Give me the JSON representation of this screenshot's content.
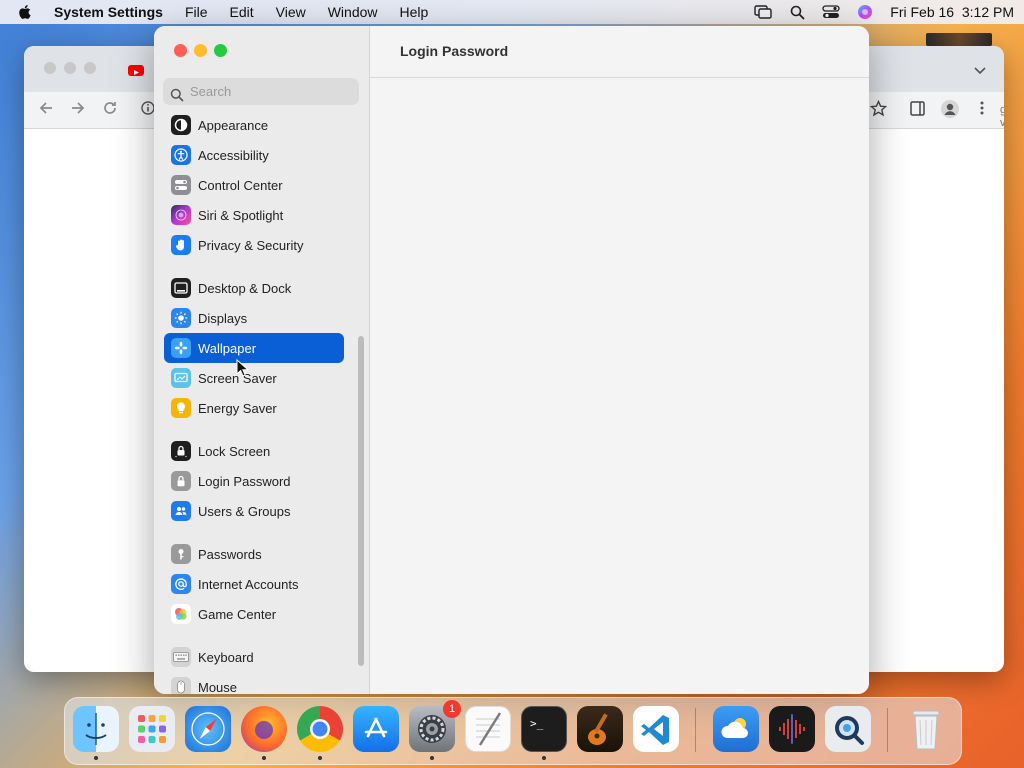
{
  "menubar": {
    "app_name": "System Settings",
    "menus": [
      "File",
      "Edit",
      "View",
      "Window",
      "Help"
    ],
    "clock": "Fri Feb 16  3:12 PM"
  },
  "browser": {
    "edge_text_1": "g",
    "edge_text_2": "v"
  },
  "settings": {
    "search_placeholder": "Search",
    "content_title": "Login Password",
    "sidebar": [
      {
        "label": "Appearance",
        "icon": "appearance-icon",
        "color": "#1f1f1f"
      },
      {
        "label": "Accessibility",
        "icon": "accessibility-icon",
        "color": "#1a73e8"
      },
      {
        "label": "Control Center",
        "icon": "control-center-icon",
        "color": "#8e8e93"
      },
      {
        "label": "Siri & Spotlight",
        "icon": "siri-icon",
        "color": "#b13ad1"
      },
      {
        "label": "Privacy & Security",
        "icon": "hand-icon",
        "color": "#1c7cf4"
      },
      {
        "label": "Desktop & Dock",
        "icon": "desktop-dock-icon",
        "color": "#1f1f1f"
      },
      {
        "label": "Displays",
        "icon": "displays-icon",
        "color": "#2a86f0"
      },
      {
        "label": "Wallpaper",
        "icon": "wallpaper-icon",
        "color": "#3aa1f2",
        "selected": true
      },
      {
        "label": "Screen Saver",
        "icon": "screen-saver-icon",
        "color": "#5bc3e8"
      },
      {
        "label": "Energy Saver",
        "icon": "energy-saver-icon",
        "color": "#f7b500"
      },
      {
        "label": "Lock Screen",
        "icon": "lock-screen-icon",
        "color": "#1f1f1f"
      },
      {
        "label": "Login Password",
        "icon": "lock-icon",
        "color": "#9a9a9a"
      },
      {
        "label": "Users & Groups",
        "icon": "users-icon",
        "color": "#1f7cf0"
      },
      {
        "label": "Passwords",
        "icon": "key-icon",
        "color": "#9a9a9a"
      },
      {
        "label": "Internet Accounts",
        "icon": "at-icon",
        "color": "#2a86f0"
      },
      {
        "label": "Game Center",
        "icon": "game-center-icon",
        "color": "#ffffff"
      },
      {
        "label": "Keyboard",
        "icon": "keyboard-icon",
        "color": "#b5b5b5"
      },
      {
        "label": "Mouse",
        "icon": "mouse-icon",
        "color": "#b5b5b5"
      }
    ]
  },
  "dock": {
    "apps": [
      {
        "name": "finder",
        "running": true
      },
      {
        "name": "launchpad",
        "running": false
      },
      {
        "name": "safari",
        "running": false
      },
      {
        "name": "firefox",
        "running": true
      },
      {
        "name": "chrome",
        "running": true
      },
      {
        "name": "app-store",
        "running": false
      },
      {
        "name": "system-settings",
        "running": true,
        "badge": "1"
      },
      {
        "name": "textedit",
        "running": false
      },
      {
        "name": "terminal",
        "running": true
      },
      {
        "name": "garageband",
        "running": false
      },
      {
        "name": "vscode",
        "running": false
      },
      {
        "name": "weather",
        "running": false
      },
      {
        "name": "voice-memos",
        "running": false
      },
      {
        "name": "quicktime",
        "running": false
      },
      {
        "name": "trash",
        "running": false
      }
    ]
  }
}
